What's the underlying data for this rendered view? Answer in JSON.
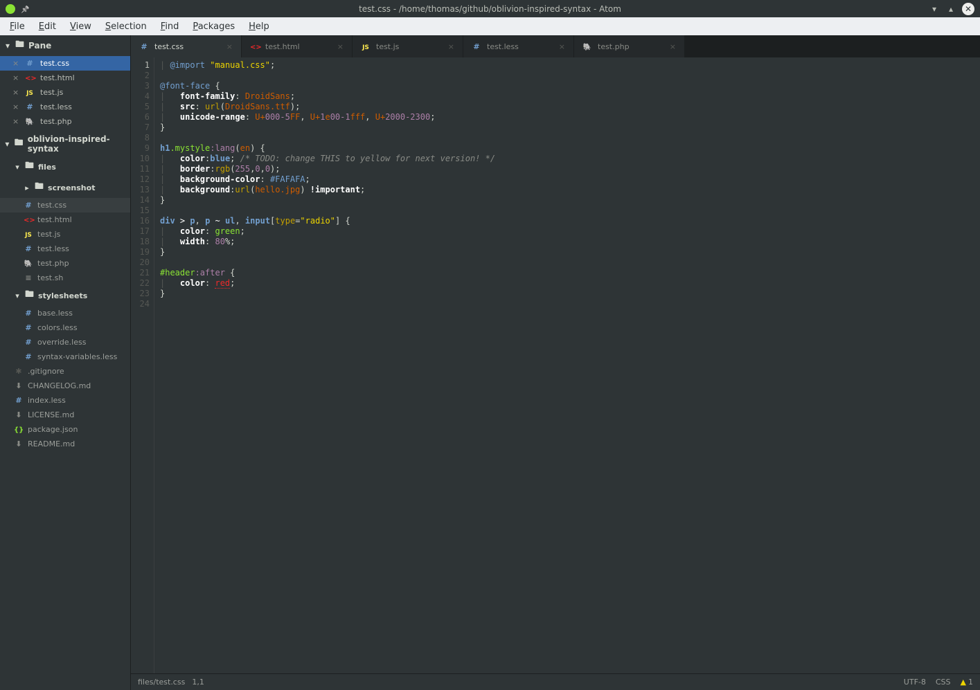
{
  "window": {
    "title": "test.css - /home/thomas/github/oblivion-inspired-syntax - Atom"
  },
  "menu": [
    "File",
    "Edit",
    "View",
    "Selection",
    "Find",
    "Packages",
    "Help"
  ],
  "pane": {
    "title": "Pane",
    "open_files": [
      {
        "icon": "css",
        "name": "test.css",
        "active": true
      },
      {
        "icon": "html",
        "name": "test.html",
        "active": false
      },
      {
        "icon": "js",
        "name": "test.js",
        "active": false
      },
      {
        "icon": "less",
        "name": "test.less",
        "active": false
      },
      {
        "icon": "php",
        "name": "test.php",
        "active": false
      }
    ]
  },
  "project": {
    "root": "oblivion-inspired-syntax",
    "tree": [
      {
        "depth": 1,
        "type": "folder",
        "open": true,
        "name": "files"
      },
      {
        "depth": 2,
        "type": "folder",
        "open": false,
        "name": "screenshot"
      },
      {
        "depth": 2,
        "type": "file",
        "icon": "css",
        "name": "test.css",
        "selected": true
      },
      {
        "depth": 2,
        "type": "file",
        "icon": "html",
        "name": "test.html"
      },
      {
        "depth": 2,
        "type": "file",
        "icon": "js",
        "name": "test.js"
      },
      {
        "depth": 2,
        "type": "file",
        "icon": "less",
        "name": "test.less"
      },
      {
        "depth": 2,
        "type": "file",
        "icon": "php",
        "name": "test.php"
      },
      {
        "depth": 2,
        "type": "file",
        "icon": "text",
        "name": "test.sh"
      },
      {
        "depth": 1,
        "type": "folder",
        "open": true,
        "name": "stylesheets"
      },
      {
        "depth": 2,
        "type": "file",
        "icon": "less",
        "name": "base.less"
      },
      {
        "depth": 2,
        "type": "file",
        "icon": "less",
        "name": "colors.less"
      },
      {
        "depth": 2,
        "type": "file",
        "icon": "less",
        "name": "override.less"
      },
      {
        "depth": 2,
        "type": "file",
        "icon": "less",
        "name": "syntax-variables.less"
      },
      {
        "depth": 1,
        "type": "file",
        "icon": "git",
        "name": ".gitignore"
      },
      {
        "depth": 1,
        "type": "file",
        "icon": "md",
        "name": "CHANGELOG.md"
      },
      {
        "depth": 1,
        "type": "file",
        "icon": "less",
        "name": "index.less"
      },
      {
        "depth": 1,
        "type": "file",
        "icon": "md",
        "name": "LICENSE.md"
      },
      {
        "depth": 1,
        "type": "file",
        "icon": "json",
        "name": "package.json"
      },
      {
        "depth": 1,
        "type": "file",
        "icon": "md",
        "name": "README.md"
      }
    ]
  },
  "tabs": [
    {
      "icon": "css",
      "name": "test.css",
      "active": true
    },
    {
      "icon": "html",
      "name": "test.html"
    },
    {
      "icon": "js",
      "name": "test.js"
    },
    {
      "icon": "less",
      "name": "test.less"
    },
    {
      "icon": "php",
      "name": "test.php"
    }
  ],
  "code": {
    "lines": 24,
    "tokens": [
      [
        [
          "pipe",
          "| "
        ],
        [
          "atrule",
          "@import"
        ],
        [
          "punct",
          " "
        ],
        [
          "str",
          "\"manual.css\""
        ],
        [
          "punct",
          ";"
        ]
      ],
      [],
      [
        [
          "atrule",
          "@font-face"
        ],
        [
          "punct",
          " {"
        ]
      ],
      [
        [
          "pipe",
          "|   "
        ],
        [
          "prop",
          "font-family"
        ],
        [
          "punct",
          ": "
        ],
        [
          "val",
          "DroidSans"
        ],
        [
          "punct",
          ";"
        ]
      ],
      [
        [
          "pipe",
          "|   "
        ],
        [
          "prop",
          "src"
        ],
        [
          "punct",
          ": "
        ],
        [
          "funcname",
          "url"
        ],
        [
          "punct",
          "("
        ],
        [
          "val",
          "DroidSans.ttf"
        ],
        [
          "punct",
          ");"
        ]
      ],
      [
        [
          "pipe",
          "|   "
        ],
        [
          "prop",
          "unicode-range"
        ],
        [
          "punct",
          ": "
        ],
        [
          "val",
          "U+"
        ],
        [
          "num",
          "000-5"
        ],
        [
          "val",
          "FF"
        ],
        [
          "punct",
          ", "
        ],
        [
          "val",
          "U+"
        ],
        [
          "num",
          "1"
        ],
        [
          "val",
          "e"
        ],
        [
          "num",
          "00-1"
        ],
        [
          "val",
          "fff"
        ],
        [
          "punct",
          ", "
        ],
        [
          "val",
          "U+"
        ],
        [
          "num",
          "2000-2300"
        ],
        [
          "punct",
          ";"
        ]
      ],
      [
        [
          "punct",
          "}"
        ]
      ],
      [],
      [
        [
          "tag",
          "h1"
        ],
        [
          "class",
          ".mystyle"
        ],
        [
          "pseudo",
          ":lang"
        ],
        [
          "punct",
          "("
        ],
        [
          "val",
          "en"
        ],
        [
          "punct",
          ") {"
        ]
      ],
      [
        [
          "pipe",
          "|   "
        ],
        [
          "prop",
          "color"
        ],
        [
          "punct",
          ":"
        ],
        [
          "color-blue",
          "blue"
        ],
        [
          "punct",
          "; "
        ],
        [
          "cmt",
          "/* TODO: change THIS to yellow for next version! */"
        ]
      ],
      [
        [
          "pipe",
          "|   "
        ],
        [
          "prop",
          "border"
        ],
        [
          "punct",
          ":"
        ],
        [
          "funcname",
          "rgb"
        ],
        [
          "punct",
          "("
        ],
        [
          "num",
          "255"
        ],
        [
          "punct",
          ","
        ],
        [
          "num",
          "0"
        ],
        [
          "punct",
          ","
        ],
        [
          "num",
          "0"
        ],
        [
          "punct",
          ");"
        ]
      ],
      [
        [
          "pipe",
          "|   "
        ],
        [
          "prop",
          "background-color"
        ],
        [
          "punct",
          ": "
        ],
        [
          "hex",
          "#FAFAFA"
        ],
        [
          "punct",
          ";"
        ]
      ],
      [
        [
          "pipe",
          "|   "
        ],
        [
          "prop",
          "background"
        ],
        [
          "punct",
          ":"
        ],
        [
          "funcname",
          "url"
        ],
        [
          "punct",
          "("
        ],
        [
          "val",
          "hello.jpg"
        ],
        [
          "punct",
          ") "
        ],
        [
          "imp",
          "!important"
        ],
        [
          "punct",
          ";"
        ]
      ],
      [
        [
          "punct",
          "}"
        ]
      ],
      [],
      [
        [
          "tag",
          "div"
        ],
        [
          "punct",
          " "
        ],
        [
          "op",
          ">"
        ],
        [
          "punct",
          " "
        ],
        [
          "tag",
          "p"
        ],
        [
          "punct",
          ", "
        ],
        [
          "tag",
          "p"
        ],
        [
          "punct",
          " "
        ],
        [
          "op",
          "~"
        ],
        [
          "punct",
          " "
        ],
        [
          "tag",
          "ul"
        ],
        [
          "punct",
          ", "
        ],
        [
          "tag",
          "input"
        ],
        [
          "punct",
          "["
        ],
        [
          "attr",
          "type"
        ],
        [
          "punct",
          "="
        ],
        [
          "str",
          "\"radio\""
        ],
        [
          "punct",
          "] {"
        ]
      ],
      [
        [
          "pipe",
          "|   "
        ],
        [
          "prop",
          "color"
        ],
        [
          "punct",
          ": "
        ],
        [
          "color-green",
          "green"
        ],
        [
          "punct",
          ";"
        ]
      ],
      [
        [
          "pipe",
          "|   "
        ],
        [
          "prop",
          "width"
        ],
        [
          "punct",
          ": "
        ],
        [
          "num",
          "80"
        ],
        [
          "unit",
          "%"
        ],
        [
          "punct",
          ";"
        ]
      ],
      [
        [
          "punct",
          "}"
        ]
      ],
      [],
      [
        [
          "id-sel",
          "#header"
        ],
        [
          "pseudo",
          ":after"
        ],
        [
          "punct",
          " {"
        ]
      ],
      [
        [
          "pipe",
          "|   "
        ],
        [
          "prop",
          "color"
        ],
        [
          "punct",
          ": "
        ],
        [
          "color-red",
          "red"
        ],
        [
          "punct",
          ";"
        ]
      ],
      [
        [
          "punct",
          "}"
        ]
      ],
      []
    ]
  },
  "status": {
    "path": "files/test.css",
    "cursor": "1,1",
    "encoding": "UTF-8",
    "lang": "CSS",
    "warnings": "1"
  }
}
